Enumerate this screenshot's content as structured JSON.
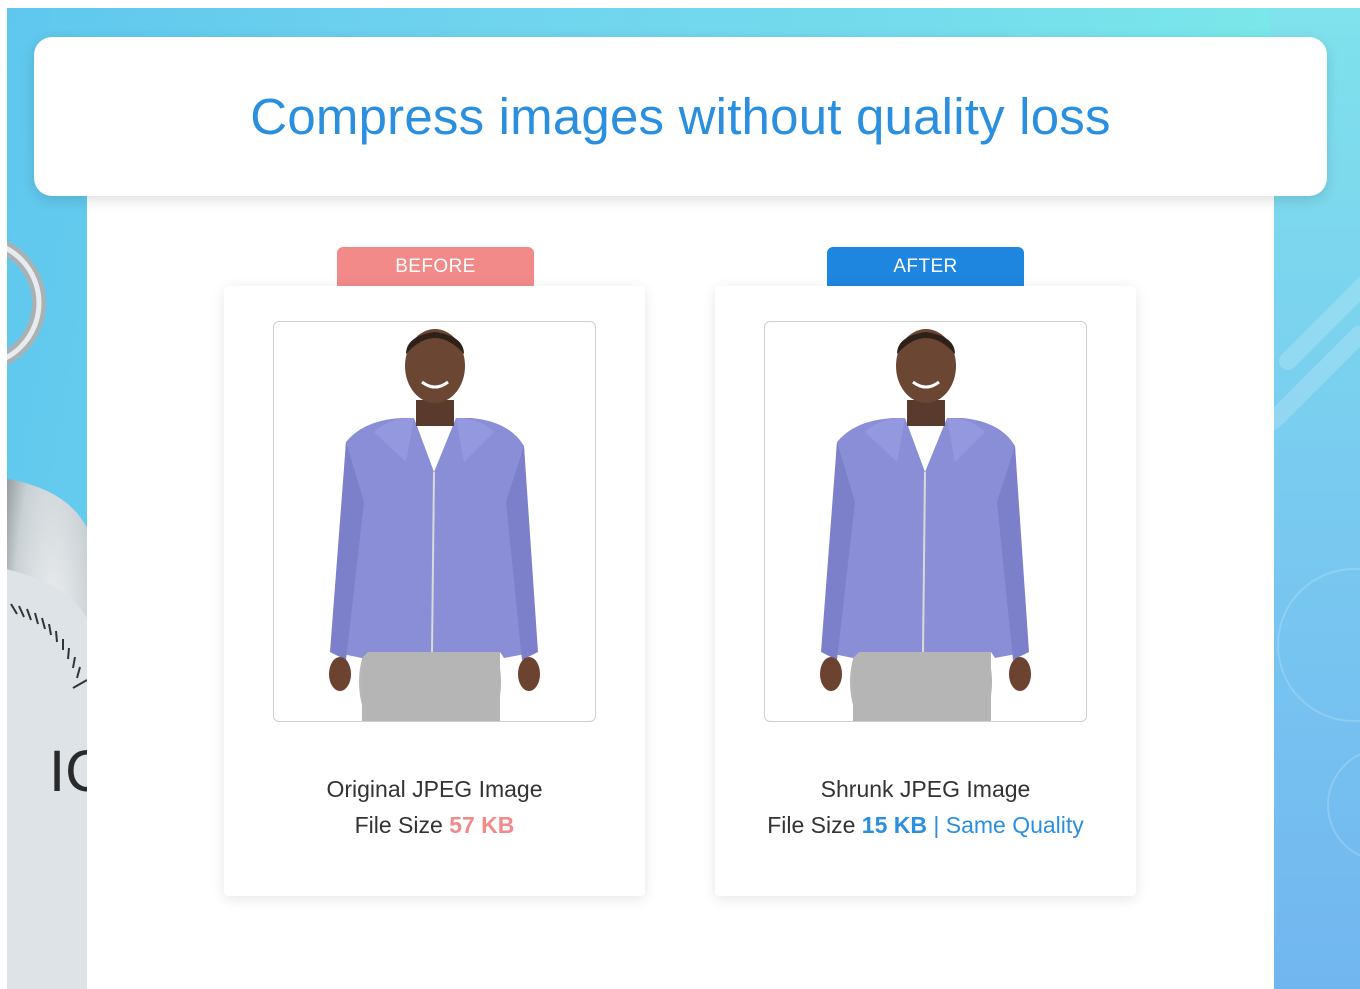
{
  "header": {
    "title": "Compress images without quality loss"
  },
  "decor": {
    "gauge_text": "IC"
  },
  "before": {
    "tag": "BEFORE",
    "tag_color": "#f28a8a",
    "caption_line1": "Original JPEG Image",
    "size_label": "File Size ",
    "size_value": "57 KB",
    "image_alt": "Man in purple zip hoodie, original"
  },
  "after": {
    "tag": "AFTER",
    "tag_color": "#1f86e0",
    "caption_line1": "Shrunk JPEG Image",
    "size_label": "File Size ",
    "size_value": "15 KB",
    "suffix": " | Same Quality",
    "image_alt": "Man in purple zip hoodie, compressed"
  }
}
